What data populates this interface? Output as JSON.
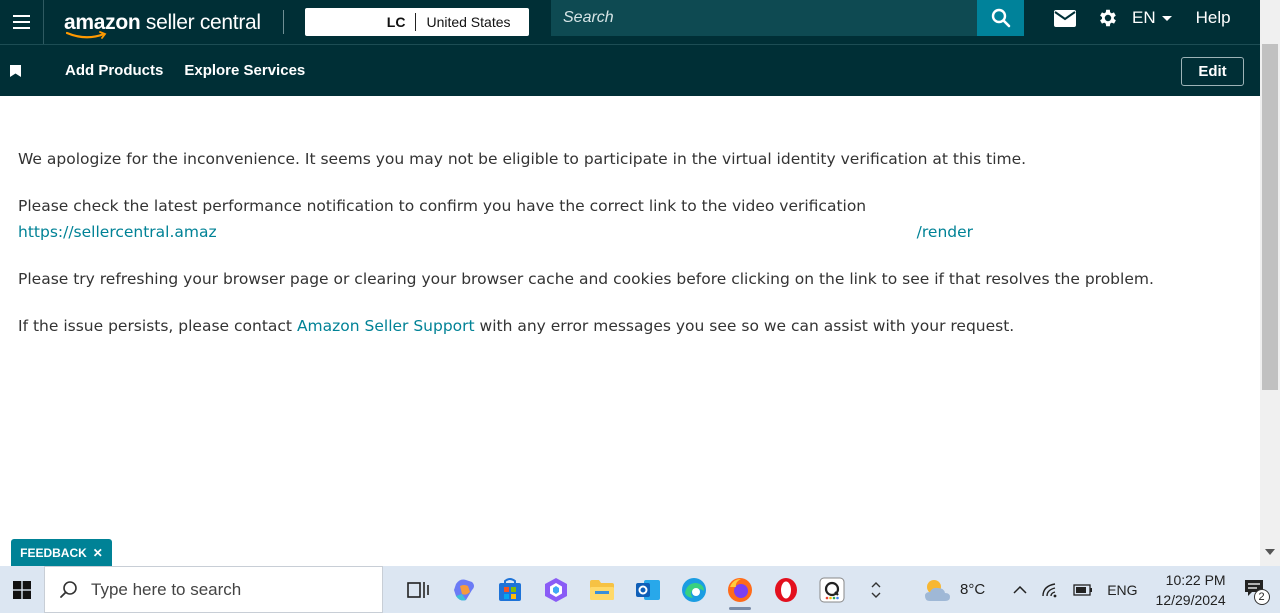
{
  "header": {
    "logo_text_bold": "amazon",
    "logo_text_light": " seller central",
    "account_code": "LC",
    "marketplace": "United States",
    "search_placeholder": "Search",
    "language": "EN",
    "help": "Help"
  },
  "nav": {
    "add_products": "Add Products",
    "explore_services": "Explore Services",
    "edit": "Edit"
  },
  "content": {
    "p1": "We apologize for the inconvenience. It seems you may not be eligible to participate in the virtual identity verification at this time.",
    "p2": "Please check the latest performance notification to confirm you have the correct link to the video verification",
    "url_start": "https://sellercentral.amaz",
    "url_end": "/render",
    "p3": "Please try refreshing your browser page or clearing your browser cache and cookies before clicking on the link to see if that resolves the problem.",
    "p4_before": "If the issue persists, please contact ",
    "p4_link": "Amazon Seller Support",
    "p4_after": " with any error messages you see so we can assist with your request."
  },
  "feedback": {
    "label": "FEEDBACK",
    "close": "✕"
  },
  "taskbar": {
    "search_placeholder": "Type here to search",
    "temperature": "8°C",
    "language": "ENG",
    "time": "10:22 PM",
    "date": "12/29/2024",
    "notification_count": "2"
  },
  "colors": {
    "header_bg": "#002f36",
    "accent": "#008296",
    "taskbar_bg": "#dce6f2"
  }
}
